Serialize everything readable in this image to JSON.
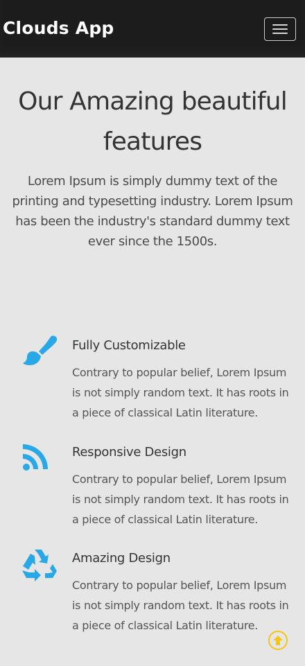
{
  "navbar": {
    "brand": "Clouds App",
    "menu_icon": "hamburger-menu-icon"
  },
  "hero": {
    "title": "Our Amazing beautiful features",
    "text": "Lorem Ipsum is simply dummy text of the printing and typesetting industry. Lorem Ipsum has been the industry's standard dummy text ever since the 1500s."
  },
  "features": [
    {
      "icon": "paint-brush-icon",
      "title": "Fully Customizable",
      "description": "Contrary to popular belief, Lorem Ipsum is not simply random text. It has roots in a piece of classical Latin literature."
    },
    {
      "icon": "rss-feed-icon",
      "title": "Responsive Design",
      "description": "Contrary to popular belief, Lorem Ipsum is not simply random text. It has roots in a piece of classical Latin literature."
    },
    {
      "icon": "recycle-icon",
      "title": "Amazing Design",
      "description": "Contrary to popular belief, Lorem Ipsum is not simply random text. It has roots in a piece of classical Latin literature."
    }
  ],
  "scroll_top_icon": "arrow-up-circle-icon",
  "colors": {
    "navbar_bg": "#1c1c1c",
    "page_bg": "#e6e6e6",
    "icon_accent": "#29a8e8",
    "scroll_top": "#f5c518"
  }
}
